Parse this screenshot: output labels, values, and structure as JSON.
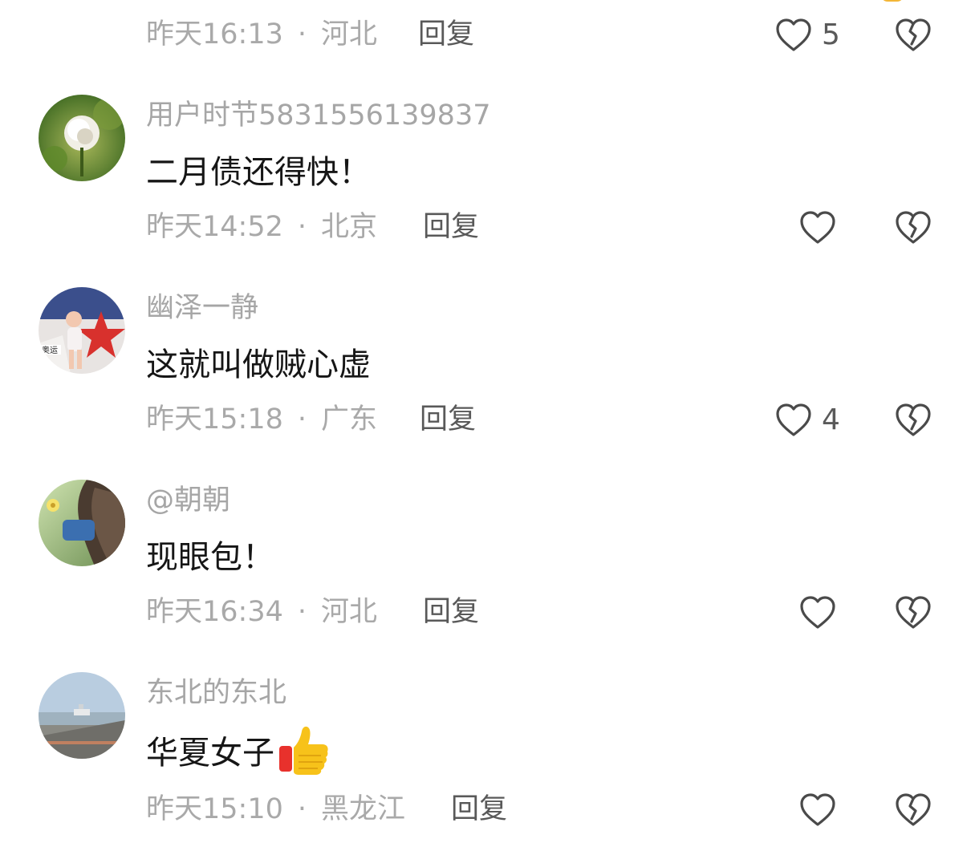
{
  "comments": [
    {
      "time": "昨天16:13",
      "location": "河北",
      "reply_label": "回复",
      "like_count": "5"
    },
    {
      "username": "用户时节5831556139837",
      "content": "二月债还得快！",
      "time": "昨天14:52",
      "location": "北京",
      "reply_label": "回复",
      "like_count": ""
    },
    {
      "username": "幽泽一静",
      "content": "这就叫做贼心虚",
      "time": "昨天15:18",
      "location": "广东",
      "reply_label": "回复",
      "like_count": "4"
    },
    {
      "username": "@朝朝",
      "content": "现眼包！",
      "time": "昨天16:34",
      "location": "河北",
      "reply_label": "回复",
      "like_count": ""
    },
    {
      "username": "东北的东北",
      "content": "华夏女子",
      "content_emoji": "thumbs-up-emoji",
      "time": "昨天15:10",
      "location": "黑龙江",
      "reply_label": "回复",
      "like_count": ""
    }
  ],
  "separator": "·",
  "icons": {
    "like": "heart-outline-icon",
    "dislike": "broken-heart-icon"
  },
  "colors": {
    "meta_text": "#a9a9a9",
    "username_text": "#a6a6a6",
    "content_text": "#161616",
    "icon_stroke": "#4a4a4a"
  }
}
